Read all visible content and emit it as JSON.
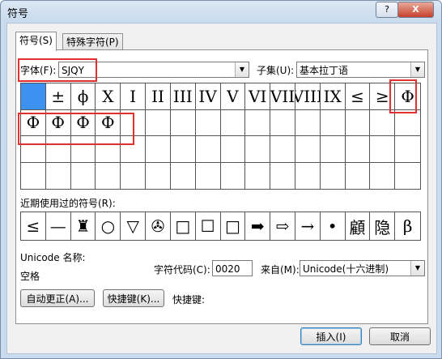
{
  "window": {
    "title": "符号",
    "help_label": "?",
    "close_label": "X"
  },
  "tabs": [
    {
      "label": "符号(S)"
    },
    {
      "label": "特殊字符(P)"
    }
  ],
  "font": {
    "label": "字体(F):",
    "value": "SJQY"
  },
  "subset": {
    "label": "子集(U):",
    "value": "基本拉丁语"
  },
  "symbols": [
    [
      "",
      "±",
      "ϕ",
      "X",
      "I",
      "II",
      "III",
      "IV",
      "V",
      "VI",
      "VII",
      "VIII",
      "IX",
      "≤",
      "≥",
      "Φ"
    ],
    [
      "Ф",
      "Ф",
      "Ф",
      "Ф",
      "",
      "",
      "",
      "",
      "",
      "",
      "",
      "",
      "",
      "",
      "",
      ""
    ],
    [
      "",
      "",
      "",
      "",
      "",
      "",
      "",
      "",
      "",
      "",
      "",
      "",
      "",
      "",
      "",
      ""
    ],
    [
      "",
      "",
      "",
      "",
      "",
      "",
      "",
      "",
      "",
      "",
      "",
      "",
      "",
      "",
      "",
      ""
    ]
  ],
  "recent": {
    "label": "近期使用过的符号(R):",
    "items": [
      "≤",
      "—",
      "♜",
      "○",
      "▽",
      "✇",
      "□",
      "☐",
      "□",
      "➡",
      "⇨",
      "→",
      "•",
      "顧",
      "隐",
      "β"
    ]
  },
  "unicode_name": {
    "label": "Unicode 名称:",
    "value": "空格"
  },
  "char_code": {
    "label": "字符代码(C):",
    "value": "0020"
  },
  "from": {
    "label": "来自(M):",
    "value": "Unicode(十六进制)"
  },
  "buttons": {
    "autocorrect": "自动更正(A)...",
    "shortcut": "快捷键(K)...",
    "shortcut_label": "快捷键:",
    "insert": "插入(I)",
    "cancel": "取消"
  },
  "colors": {
    "selection": "#3d92f0",
    "highlight": "#e23030"
  }
}
